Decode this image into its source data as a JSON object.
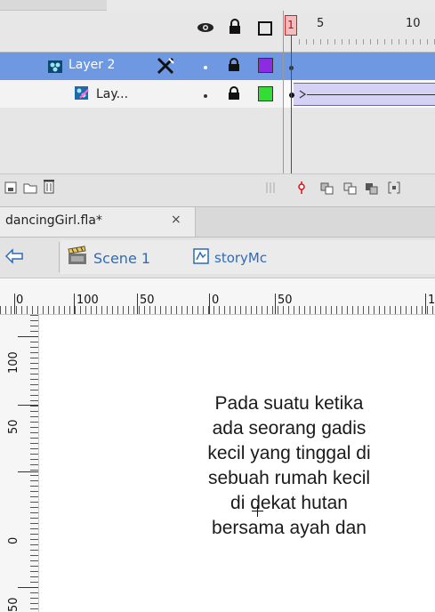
{
  "timeline": {
    "frame_numbers": [
      "5",
      "10"
    ],
    "current_frame": "1",
    "layers": [
      {
        "name": "Layer 2",
        "selected": true,
        "color": "#8b2be2"
      },
      {
        "name": "Lay...",
        "selected": false,
        "color": "#33dd33"
      }
    ]
  },
  "document": {
    "tab_label": "dancingGirl.fla*",
    "tab_close": "×"
  },
  "editbar": {
    "scene_label": "Scene 1",
    "symbol_label": "storyMc"
  },
  "rulers": {
    "h_labels": [
      "0",
      "100",
      "50",
      "0",
      "50",
      "1"
    ],
    "v_labels": [
      "100",
      "50",
      "0",
      "50"
    ]
  },
  "stage": {
    "lines": [
      "Pada suatu ketika",
      "ada seorang gadis",
      "kecil yang tinggal di",
      "sebuah rumah kecil",
      "di dekat hutan",
      "bersama ayah dan"
    ]
  },
  "colors": {
    "selected_row": "#6e98e2",
    "playhead": "#d11111",
    "tween": "#d4d1f5"
  }
}
